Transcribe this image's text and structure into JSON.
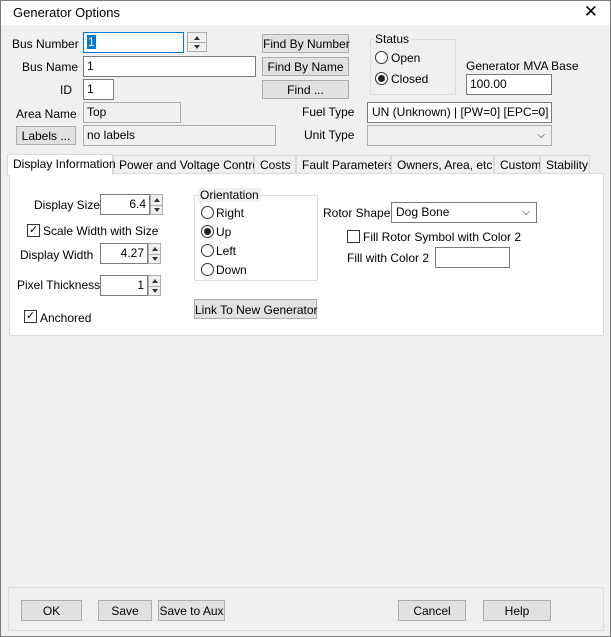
{
  "window": {
    "title": "Generator Options"
  },
  "header": {
    "bus_number_label": "Bus Number",
    "bus_number_value": "1",
    "bus_name_label": "Bus Name",
    "bus_name_value": "1",
    "id_label": "ID",
    "id_value": "1",
    "area_name_label": "Area Name",
    "area_name_value": "Top",
    "labels_button": "Labels ...",
    "labels_value": "no labels",
    "find_by_number": "Find By Number",
    "find_by_name": "Find By Name",
    "find": "Find ...",
    "fuel_type_label": "Fuel Type",
    "fuel_type_value": "UN (Unknown) | [PW=0] [EPC=0]",
    "unit_type_label": "Unit Type",
    "unit_type_value": "",
    "status_title": "Status",
    "status_open": "Open",
    "status_closed": "Closed",
    "mva_label": "Generator MVA Base",
    "mva_value": "100.00"
  },
  "tabs": [
    {
      "label": "Display Information",
      "active": true
    },
    {
      "label": "Power and Voltage Control"
    },
    {
      "label": "Costs"
    },
    {
      "label": "Fault Parameters"
    },
    {
      "label": "Owners, Area, etc"
    },
    {
      "label": "Custom"
    },
    {
      "label": "Stability"
    }
  ],
  "display": {
    "display_size_label": "Display Size",
    "display_size_value": "6.4",
    "scale_width_label": "Scale Width with Size",
    "display_width_label": "Display Width",
    "display_width_value": "4.27",
    "pixel_thickness_label": "Pixel Thickness",
    "pixel_thickness_value": "1",
    "anchored_label": "Anchored",
    "orientation_title": "Orientation",
    "orientation_right": "Right",
    "orientation_up": "Up",
    "orientation_left": "Left",
    "orientation_down": "Down",
    "link_button": "Link To New Generator",
    "rotor_shape_label": "Rotor Shape",
    "rotor_shape_value": "Dog Bone",
    "fill_rotor_label": "Fill Rotor Symbol with Color 2",
    "fill_color2_label": "Fill with Color 2"
  },
  "footer": {
    "ok": "OK",
    "save": "Save",
    "save_to_aux": "Save to Aux",
    "cancel": "Cancel",
    "help": "Help"
  }
}
